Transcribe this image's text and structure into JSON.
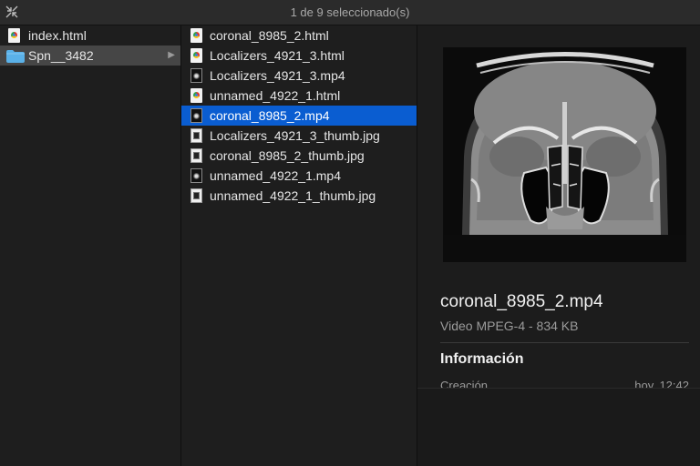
{
  "window": {
    "title": "1 de 9 seleccionado(s)"
  },
  "column1": {
    "items": [
      {
        "label": "index.html",
        "kind": "html"
      },
      {
        "label": "Spn__3482",
        "kind": "folder"
      }
    ]
  },
  "column2": {
    "items": [
      {
        "label": "coronal_8985_2.html",
        "kind": "html"
      },
      {
        "label": "Localizers_4921_3.html",
        "kind": "html"
      },
      {
        "label": "Localizers_4921_3.mp4",
        "kind": "mp4"
      },
      {
        "label": "unnamed_4922_1.html",
        "kind": "html"
      },
      {
        "label": "coronal_8985_2.mp4",
        "kind": "mp4"
      },
      {
        "label": "Localizers_4921_3_thumb.jpg",
        "kind": "jpg"
      },
      {
        "label": "coronal_8985_2_thumb.jpg",
        "kind": "jpg"
      },
      {
        "label": "unnamed_4922_1.mp4",
        "kind": "mp4"
      },
      {
        "label": "unnamed_4922_1_thumb.jpg",
        "kind": "jpg"
      }
    ],
    "selected_index": 4
  },
  "preview": {
    "file_name": "coronal_8985_2.mp4",
    "file_meta": "Video MPEG-4 - 834 KB",
    "info_heading": "Información",
    "created_label": "Creación",
    "created_value": "hoy, 12:42"
  },
  "colors": {
    "selection": "#0a5dd1",
    "folder_selection": "#464646",
    "folder": "#5ab1e8"
  }
}
